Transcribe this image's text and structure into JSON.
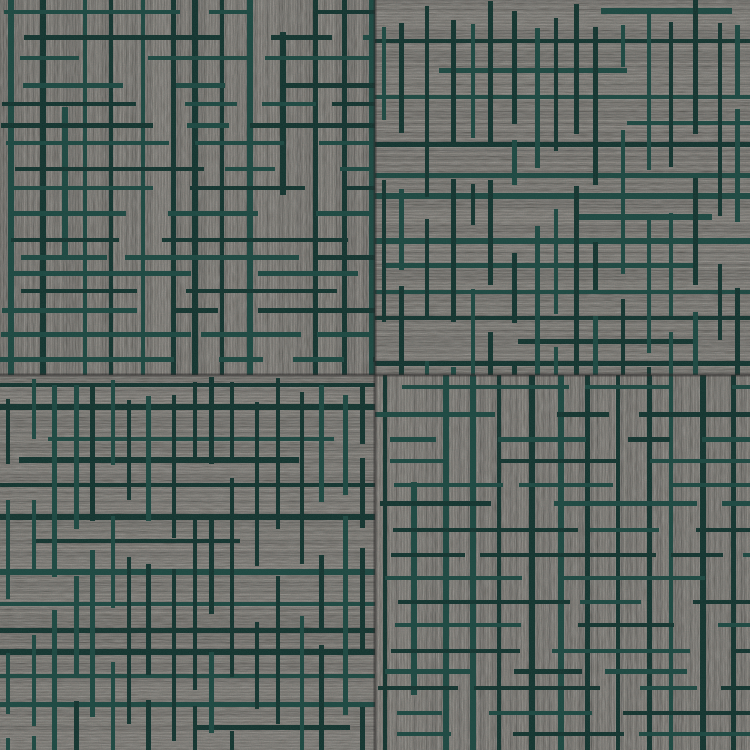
{
  "texture": {
    "subject": "carpet-tile",
    "tiles": [
      {
        "id": "top-left",
        "orientation": "standard"
      },
      {
        "id": "top-right",
        "orientation": "rotated"
      },
      {
        "id": "bottom-left",
        "orientation": "rotated"
      },
      {
        "id": "bottom-right",
        "orientation": "standard"
      }
    ],
    "colors": {
      "base": "#6a645f",
      "base_light": "#8b847e",
      "base_dark": "#4a4542",
      "stripe": "#1f4a43",
      "stripe_dark": "#153530",
      "seam": "#2b2a29"
    }
  }
}
